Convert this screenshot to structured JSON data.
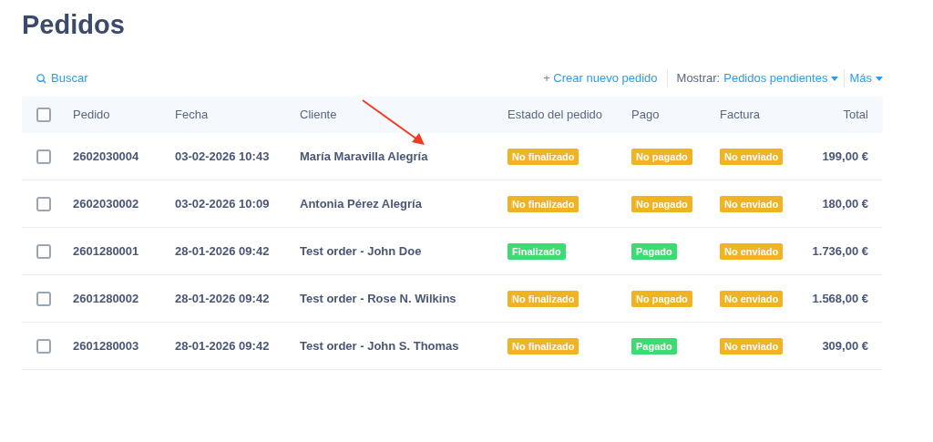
{
  "title": "Pedidos",
  "toolbar": {
    "search": "Buscar",
    "create": "+ Crear nuevo pedido",
    "show_label": "Mostrar:",
    "show_value": "Pedidos pendientes",
    "more": "Más"
  },
  "table": {
    "select_all": {
      "checked": false
    },
    "columns": [
      "Pedido",
      "Fecha",
      "Cliente",
      "Estado del pedido",
      "Pago",
      "Factura",
      "Total"
    ],
    "rows": [
      {
        "checked": false,
        "order": "2602030004",
        "date": "03-02-2026 10:43",
        "client": "María Maravilla Alegría",
        "status": {
          "text": "No finalizado",
          "color": "#f0b323"
        },
        "payment": {
          "text": "No pagado",
          "color": "#f0b323"
        },
        "invoice": {
          "text": "No enviado",
          "color": "#f0b323"
        },
        "total": "199,00 €"
      },
      {
        "checked": false,
        "order": "2602030002",
        "date": "03-02-2026 10:09",
        "client": "Antonia Pérez Alegría",
        "status": {
          "text": "No finalizado",
          "color": "#f0b323"
        },
        "payment": {
          "text": "No pagado",
          "color": "#f0b323"
        },
        "invoice": {
          "text": "No enviado",
          "color": "#f0b323"
        },
        "total": "180,00 €"
      },
      {
        "checked": false,
        "order": "2601280001",
        "date": "28-01-2026 09:42",
        "client": "Test order - John Doe",
        "status": {
          "text": "Finalizado",
          "color": "#3ddc72"
        },
        "payment": {
          "text": "Pagado",
          "color": "#3ddc72"
        },
        "invoice": {
          "text": "No enviado",
          "color": "#f0b323"
        },
        "total": "1.736,00 €"
      },
      {
        "checked": false,
        "order": "2601280002",
        "date": "28-01-2026 09:42",
        "client": "Test order - Rose N. Wilkins",
        "status": {
          "text": "No finalizado",
          "color": "#f0b323"
        },
        "payment": {
          "text": "No pagado",
          "color": "#f0b323"
        },
        "invoice": {
          "text": "No enviado",
          "color": "#f0b323"
        },
        "total": "1.568,00 €"
      },
      {
        "checked": false,
        "order": "2601280003",
        "date": "28-01-2026 09:42",
        "client": "Test order - John S. Thomas",
        "status": {
          "text": "No finalizado",
          "color": "#f0b323"
        },
        "payment": {
          "text": "Pagado",
          "color": "#3ddc72"
        },
        "invoice": {
          "text": "No enviado",
          "color": "#f0b323"
        },
        "total": "309,00 €"
      }
    ]
  }
}
